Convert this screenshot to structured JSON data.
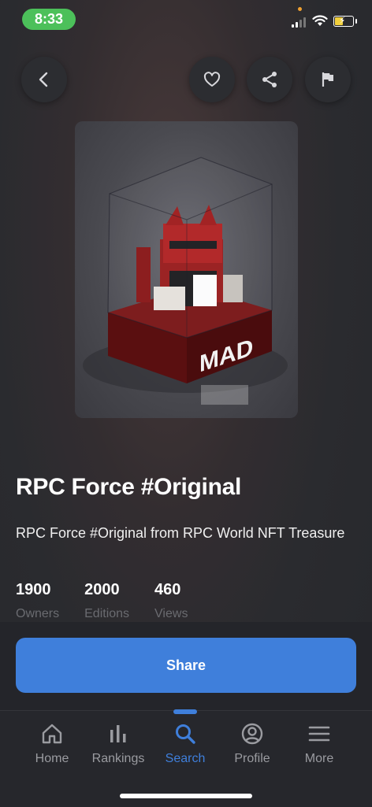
{
  "status": {
    "time": "8:33"
  },
  "nft": {
    "title": "RPC Force #Original",
    "description": "RPC Force #Original from RPC World NFT Treasure",
    "logo_text": "MAD"
  },
  "stats": [
    {
      "value": "1900",
      "label": "Owners"
    },
    {
      "value": "2000",
      "label": "Editions"
    },
    {
      "value": "460",
      "label": "Views"
    }
  ],
  "actions": {
    "share_label": "Share"
  },
  "tabs": [
    {
      "label": "Home",
      "icon": "home-icon"
    },
    {
      "label": "Rankings",
      "icon": "bar-chart-icon"
    },
    {
      "label": "Search",
      "icon": "search-icon"
    },
    {
      "label": "Profile",
      "icon": "profile-icon"
    },
    {
      "label": "More",
      "icon": "menu-icon"
    }
  ],
  "active_tab": "Search",
  "colors": {
    "accent": "#3f7fdb",
    "background": "#2a2b2f",
    "time_pill": "#4cc05a"
  }
}
